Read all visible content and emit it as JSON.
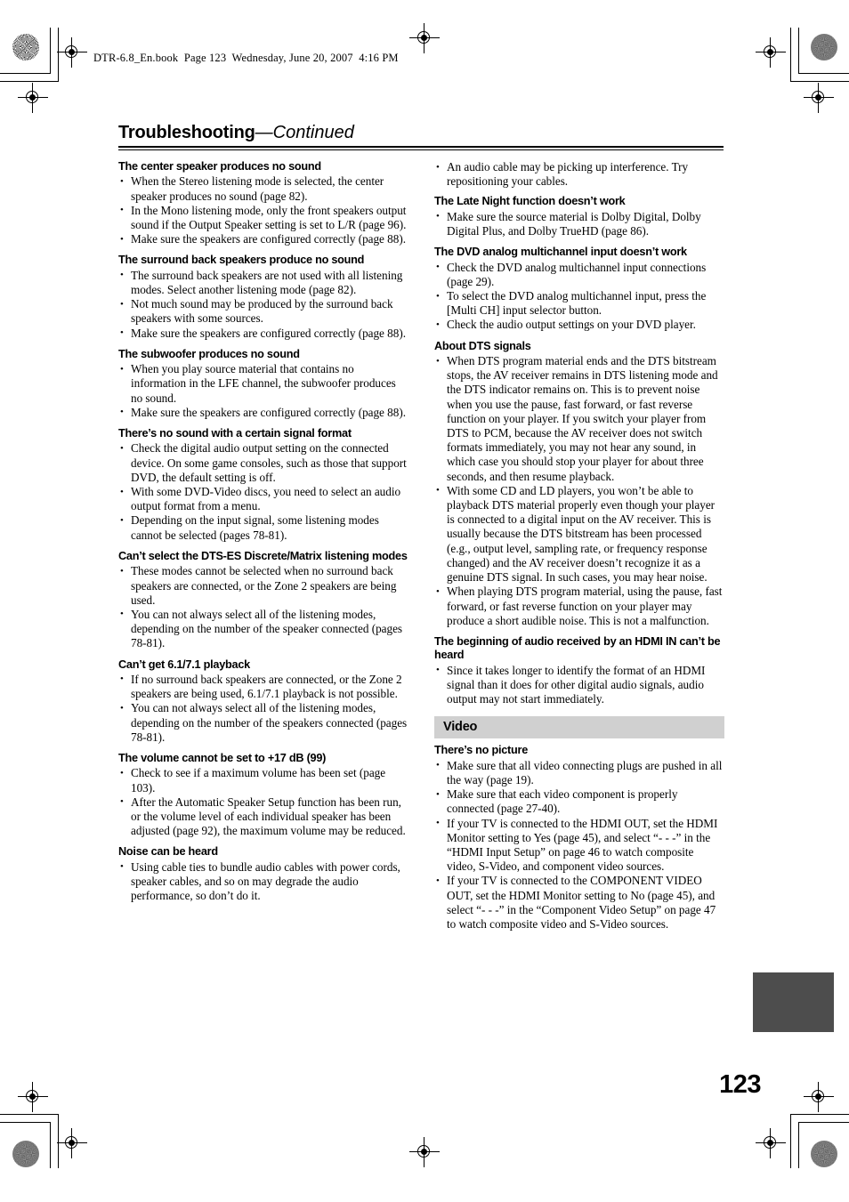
{
  "document": {
    "file_header": "DTR-6.8_En.book  Page 123  Wednesday, June 20, 2007  4:16 PM",
    "title_main": "Troubleshooting",
    "title_continued": "—Continued",
    "page_number": "123",
    "colors": {
      "band_background": "#d0d0d0",
      "thumb_tab": "#4d4d4d",
      "text": "#000000",
      "page_background": "#ffffff"
    }
  },
  "left_column": {
    "sections": [
      {
        "heading": "The center speaker produces no sound",
        "bullets": [
          "When the Stereo listening mode is selected, the center speaker produces no sound (page 82).",
          "In the Mono listening mode, only the front speakers output sound if the Output Speaker setting is set to L/R (page 96).",
          "Make sure the speakers are configured correctly (page 88)."
        ]
      },
      {
        "heading": "The surround back speakers produce no sound",
        "bullets": [
          "The surround back speakers are not used with all listening modes. Select another listening mode (page 82).",
          "Not much sound may be produced by the surround back speakers with some sources.",
          "Make sure the speakers are configured correctly (page 88)."
        ]
      },
      {
        "heading": "The subwoofer produces no sound",
        "bullets": [
          "When you play source material that contains no information in the LFE channel, the subwoofer produces no sound.",
          "Make sure the speakers are configured correctly (page 88)."
        ]
      },
      {
        "heading": "There’s no sound with a certain signal format",
        "bullets": [
          "Check the digital audio output setting on the connected device. On some game consoles, such as those that support DVD, the default setting is off.",
          "With some DVD-Video discs, you need to select an audio output format from a menu.",
          "Depending on the input signal, some listening modes cannot be selected (pages 78-81)."
        ]
      },
      {
        "heading": "Can’t select the DTS-ES Discrete/Matrix listening modes",
        "bullets": [
          "These modes cannot be selected when no surround back speakers are connected, or the Zone 2 speakers are being used.",
          "You can not always select all of the listening modes, depending on the number of the speaker connected (pages 78-81)."
        ]
      },
      {
        "heading": "Can’t get 6.1/7.1 playback",
        "bullets": [
          "If no surround back speakers are connected, or the Zone 2 speakers are being used, 6.1/7.1 playback is not possible.",
          "You can not always select all of the listening modes, depending on the number of the speakers connected (pages 78-81)."
        ]
      },
      {
        "heading": "The volume cannot be set to +17 dB (99)",
        "bullets": [
          "Check to see if a maximum volume has been set (page 103).",
          "After the Automatic Speaker Setup function has been run, or the volume level of each individual speaker has been adjusted (page 92), the maximum volume may be reduced."
        ]
      },
      {
        "heading": "Noise can be heard",
        "bullets": [
          "Using cable ties to bundle audio cables with power cords, speaker cables, and so on may degrade the audio performance, so don’t do it."
        ]
      }
    ]
  },
  "right_column": {
    "lead_bullets": [
      "An audio cable may be picking up interference. Try repositioning your cables."
    ],
    "sections": [
      {
        "heading": "The Late Night function doesn’t work",
        "bullets": [
          "Make sure the source material is Dolby Digital, Dolby Digital Plus, and Dolby TrueHD (page 86)."
        ]
      },
      {
        "heading": "The DVD analog multichannel input doesn’t work",
        "bullets": [
          "Check the DVD analog multichannel input connections (page 29).",
          "To select the DVD analog multichannel input, press the [Multi CH] input selector button.",
          "Check the audio output settings on your DVD player."
        ]
      },
      {
        "heading": "About DTS signals",
        "bullets": [
          "When DTS program material ends and the DTS bitstream stops, the AV receiver remains in DTS listening mode and the DTS indicator remains on. This is to prevent noise when you use the pause, fast forward, or fast reverse function on your player. If you switch your player from DTS to PCM, because the AV receiver does not switch formats immediately, you may not hear any sound, in which case you should stop your player for about three seconds, and then resume playback.",
          "With some CD and LD players, you won’t be able to playback DTS material properly even though your player is connected to a digital input on the AV receiver. This is usually because the DTS bitstream has been processed (e.g., output level, sampling rate, or frequency response changed) and the AV receiver doesn’t recognize it as a genuine DTS signal. In such cases, you may hear noise.",
          "When playing DTS program material, using the pause, fast forward, or fast reverse function on your player may produce a short audible noise. This is not a malfunction."
        ]
      },
      {
        "heading": "The beginning of audio received by an HDMI IN can’t be heard",
        "bullets": [
          "Since it takes longer to identify the format of an HDMI signal than it does for other digital audio signals, audio output may not start immediately."
        ]
      }
    ],
    "band_label": "Video",
    "video_sections": [
      {
        "heading": "There’s no picture",
        "bullets": [
          "Make sure that all video connecting plugs are pushed in all the way (page 19).",
          "Make sure that each video component is properly connected (page 27-40).",
          "If your TV is connected to the HDMI OUT, set the HDMI Monitor setting to Yes (page 45), and select “- - -” in the “HDMI Input Setup” on page 46 to watch composite video, S-Video, and component video sources.",
          "If your TV is connected to the COMPONENT VIDEO OUT, set the HDMI Monitor setting to No (page 45), and select “- - -” in the “Component Video Setup” on page 47 to watch composite video and S-Video sources."
        ]
      }
    ]
  }
}
